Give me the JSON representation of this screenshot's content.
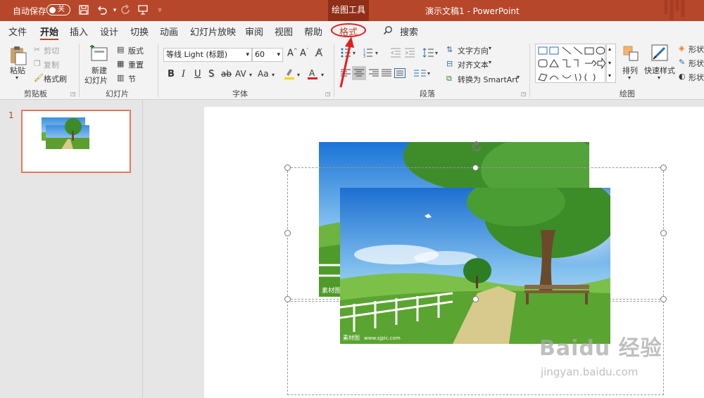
{
  "titlebar": {
    "autosave_label": "自动保存",
    "autosave_state": "关",
    "context_tab_group": "绘图工具",
    "window_title": "演示文稿1 - PowerPoint",
    "bg_color": "#b7472a"
  },
  "tabs": [
    {
      "label": "文件"
    },
    {
      "label": "开始"
    },
    {
      "label": "插入"
    },
    {
      "label": "设计"
    },
    {
      "label": "切换"
    },
    {
      "label": "动画"
    },
    {
      "label": "幻灯片放映"
    },
    {
      "label": "审阅"
    },
    {
      "label": "视图"
    },
    {
      "label": "帮助"
    },
    {
      "label": "格式"
    }
  ],
  "search_label": "搜索",
  "ribbon": {
    "clipboard": {
      "paste": "粘贴",
      "cut": "剪切",
      "copy": "复制",
      "format_painter": "格式刷",
      "group": "剪贴板"
    },
    "slides": {
      "new_slide_1": "新建",
      "new_slide_2": "幻灯片",
      "layout": "版式",
      "reset": "重置",
      "section": "节",
      "group": "幻灯片"
    },
    "font": {
      "font_name": "等线 Light (标题)",
      "font_size": "60",
      "bold": "B",
      "italic": "I",
      "underline": "U",
      "shadow": "S",
      "strike": "ab",
      "spacing": "AV",
      "case": "Aa",
      "group": "字体"
    },
    "paragraph": {
      "text_direction": "文字方向",
      "align_text": "对齐文本",
      "smartart": "转换为 SmartArt",
      "group": "段落"
    },
    "drawing": {
      "arrange": "排列",
      "quick_styles": "快速样式",
      "fill": "形状",
      "outline": "形状",
      "effects": "形状",
      "group": "绘图"
    }
  },
  "slides_pane": {
    "slide_number": "1"
  },
  "watermark": {
    "line1": "Baidu 经验",
    "line2": "jingyan.baidu.com"
  },
  "photo_caption_left": "素材图",
  "photo_caption_url": "www.sjpic.com"
}
